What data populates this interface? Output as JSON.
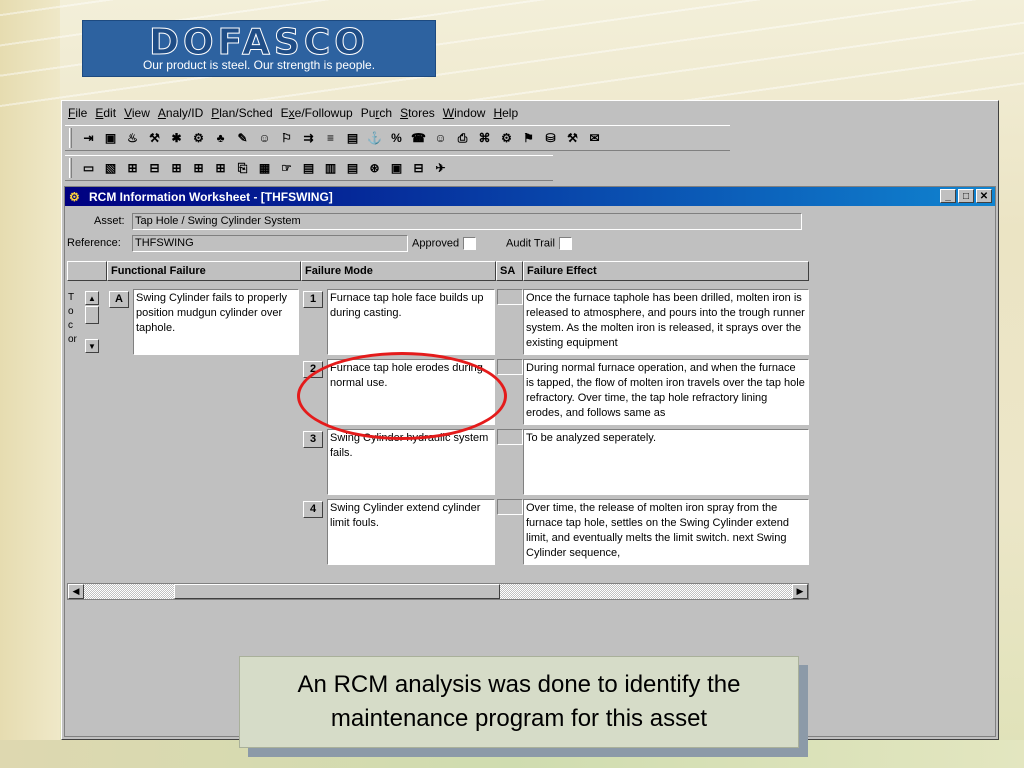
{
  "logo": {
    "word": "DOFASCO",
    "tagline": "Our product is steel. Our strength is people."
  },
  "menu": [
    {
      "pre": "",
      "u": "F",
      "post": "ile"
    },
    {
      "pre": "",
      "u": "E",
      "post": "dit"
    },
    {
      "pre": "",
      "u": "V",
      "post": "iew"
    },
    {
      "pre": "",
      "u": "A",
      "post": "naly/ID"
    },
    {
      "pre": "",
      "u": "P",
      "post": "lan/Sched"
    },
    {
      "pre": "E",
      "u": "x",
      "post": "e/Followup"
    },
    {
      "pre": "Pu",
      "u": "r",
      "post": "ch"
    },
    {
      "pre": "",
      "u": "S",
      "post": "tores"
    },
    {
      "pre": "",
      "u": "W",
      "post": "indow"
    },
    {
      "pre": "",
      "u": "H",
      "post": "elp"
    }
  ],
  "toolbar1": [
    "⇥",
    "▣",
    "♨",
    "⚒",
    "✱",
    "⚙",
    "♣",
    "✎",
    "☺",
    "⚐",
    "⇉",
    "≡",
    "▤",
    "⚓",
    "%",
    "☎",
    "☺",
    "⎙",
    "⌘",
    "⚙",
    "⚑",
    "⛁",
    "⚒",
    "✉"
  ],
  "toolbar2": [
    "▭",
    "▧",
    "⊞",
    "⊟",
    "⊞",
    "⊞",
    "⊞",
    "⎘",
    "▦",
    "☞",
    "▤",
    "▥",
    "▤",
    "⊛",
    "▣",
    "⊟",
    "✈"
  ],
  "window": {
    "title": "RCM Information Worksheet - [THFSWING]",
    "asset_label": "Asset:",
    "asset_value": "Tap Hole / Swing Cylinder System",
    "reference_label": "Reference:",
    "reference_value": "THFSWING",
    "approved_label": "Approved",
    "audit_label": "Audit Trail"
  },
  "grid": {
    "headers": {
      "functional_failure": "Functional Failure",
      "failure_mode": "Failure Mode",
      "sa": "SA",
      "failure_effect": "Failure Effect"
    },
    "functional_failure": {
      "letter": "A",
      "text": "Swing Cylinder fails to properly position mudgun cylinder over taphole."
    },
    "clipped_left": [
      "T",
      "o",
      "c",
      "or"
    ],
    "rows": [
      {
        "num": "1",
        "mode": "Furnace tap hole face builds up during casting.",
        "effect": "Once the furnace taphole has been drilled, molten iron is released to atmosphere, and pours into the trough runner system.  As the molten iron is released, it sprays over the existing equipment"
      },
      {
        "num": "2",
        "mode": "Furnace tap hole erodes during normal use.",
        "effect": "During normal furnace operation, and when the furnace is tapped, the flow of molten iron travels over the tap hole refractory.  Over time, the tap hole refractory lining erodes, and follows same as"
      },
      {
        "num": "3",
        "mode": "Swing Cylinder hydraulic system fails.",
        "effect": "To be analyzed seperately."
      },
      {
        "num": "4",
        "mode": "Swing Cylinder extend cylinder limit fouls.",
        "effect": "Over time, the release of molten iron spray from the furnace tap hole, settles on the Swing Cylinder extend limit, and eventually melts the limit switch. next Swing Cylinder sequence,"
      }
    ]
  },
  "caption": {
    "line1": "An RCM analysis was done to identify the",
    "line2": "maintenance program for this asset"
  },
  "colors": {
    "title_bar": "#000080",
    "annotation": "#e41b1b",
    "logo_blue": "#2d62a0"
  }
}
